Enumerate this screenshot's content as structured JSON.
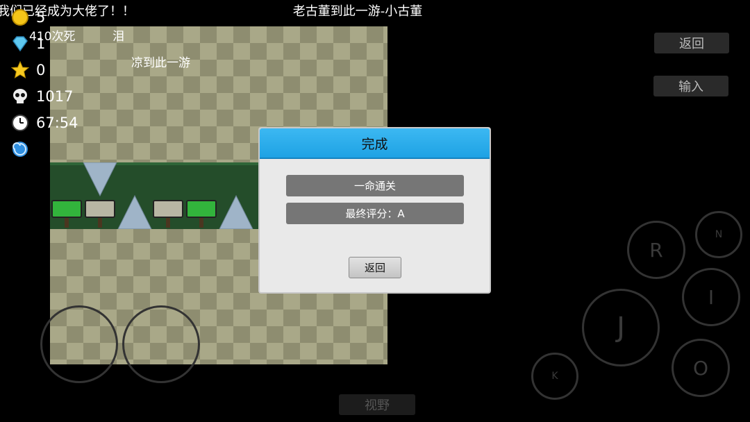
{
  "marquee": "我们已经成为大佬了！！",
  "window_title": "老古董到此一游-小古董",
  "hud": {
    "coins": "5",
    "gems": "1",
    "stars": "0",
    "deaths": "1017",
    "time": "67:54"
  },
  "level_text": {
    "deaths_caption": "410次死",
    "tear": "泪",
    "cool": "凉到此一游"
  },
  "side_buttons": {
    "back": "返回",
    "input": "输入"
  },
  "dialog": {
    "title": "完成",
    "line1": "一命通关",
    "line2": "最终评分：A",
    "back": "返回"
  },
  "controls": {
    "r": "R",
    "n": "N",
    "i": "I",
    "j": "J",
    "k": "K",
    "o": "O",
    "view": "视野"
  },
  "colors": {
    "dialog_header": "#29acec",
    "corridor": "#244d2a"
  }
}
